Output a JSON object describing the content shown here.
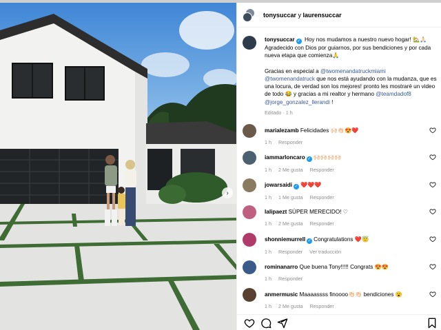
{
  "header": {
    "user1": "tonysuccar",
    "joiner": " y ",
    "user2": "laurensuccar"
  },
  "caption": {
    "user": "tonysuccar",
    "line1": " Hoy nos mudamos a nuestro nuevo hogar! 🏡🙏🏻 Agradecido con Dios por guiarnos, por sus bendiciones y por cada nueva etapa que comienza🙏",
    "p2_a": "Gracias en especial a ",
    "mention1": "@twomenandatruckmiami",
    "mention2": "@twomenandatruck",
    "p2_b": " que nos está ayudando con la mudanza, que es una locura, de verdad son los mejores! pronto les mostraré un video de todo 😂 y gracias a mi realtor y hermano ",
    "mention3": "@teamdadof8",
    "mention4": "@jorge_gonzalez_llerandi",
    "p2_c": " !",
    "edited": "Editado · 1 h"
  },
  "comments": [
    {
      "user": "marialezamb",
      "verified": false,
      "text": "Felicidades 🙌🏻👏🏻😍❤️",
      "time": "1 h",
      "likes": "",
      "reply": "Responder",
      "extra": "",
      "avatar_color": "#6b5a4a"
    },
    {
      "user": "iammarloncaro",
      "verified": true,
      "text": "🙌🏻🙌🏻🙌🏻🙌🏻",
      "time": "1 h",
      "likes": "2 Me gusta",
      "reply": "Responder",
      "extra": "",
      "avatar_color": "#4b6070"
    },
    {
      "user": "jowarsaidi",
      "verified": true,
      "text": "❤️❤️❤️",
      "time": "1 h",
      "likes": "1 Me gusta",
      "reply": "Responder",
      "extra": "",
      "avatar_color": "#8a7a60"
    },
    {
      "user": "lalipaezt",
      "verified": false,
      "text": "SÚPER MERECIDO! ♡",
      "time": "1 h",
      "likes": "2 Me gusta",
      "reply": "Responder",
      "extra": "",
      "avatar_color": "#c06080"
    },
    {
      "user": "shonniemurrell",
      "verified": true,
      "text": "Congratulations ❤️😇",
      "time": "1 h",
      "likes": "",
      "reply": "Responder",
      "extra": "Ver traducción",
      "avatar_color": "#b03a6a"
    },
    {
      "user": "rominanarro",
      "verified": false,
      "text": "Que buena Tony!!!!! Congrats 😍😍",
      "time": "1 h",
      "likes": "",
      "reply": "Responder",
      "extra": "",
      "avatar_color": "#3a5a8a"
    },
    {
      "user": "anmermusic",
      "verified": false,
      "text": "Maaaassss finoooo👏🏻👏🏻 bendiciones 😮",
      "time": "1 h",
      "likes": "2 Me gusta",
      "reply": "Responder",
      "extra": "",
      "avatar_color": "#5a4030"
    }
  ],
  "icons": {
    "like": "heart-icon",
    "comment": "comment-icon",
    "share": "share-icon",
    "save": "bookmark-icon",
    "next": "chevron-right-icon"
  },
  "colors": {
    "link": "#37589b",
    "verified": "#1d9bf0",
    "meta": "#8e8e8e"
  }
}
